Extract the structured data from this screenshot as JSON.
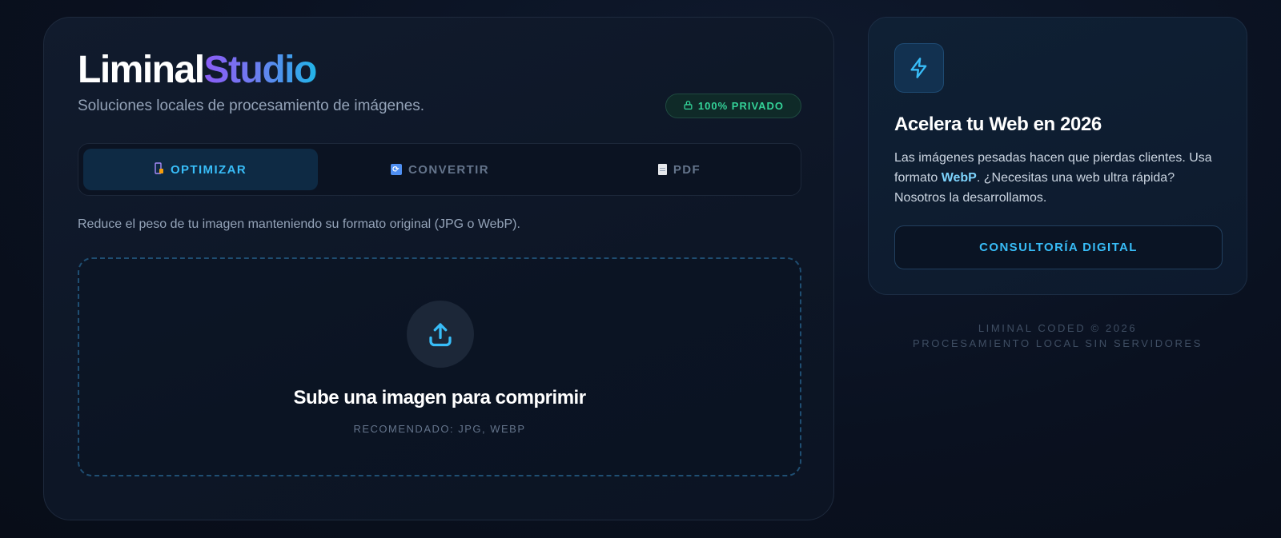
{
  "brand": {
    "name_part1": "Liminal",
    "name_part2": "Studio",
    "tagline": "Soluciones locales de procesamiento de imágenes."
  },
  "privacy_badge": {
    "label": "100% PRIVADO"
  },
  "tabs": [
    {
      "label": "OPTIMIZAR",
      "icon": "compress-icon",
      "active": true
    },
    {
      "label": "CONVERTIR",
      "icon": "convert-icon",
      "active": false
    },
    {
      "label": "PDF",
      "icon": "document-icon",
      "active": false
    }
  ],
  "description": "Reduce el peso de tu imagen manteniendo su formato original (JPG o WebP).",
  "dropzone": {
    "title": "Sube una imagen para comprimir",
    "hint": "RECOMENDADO: JPG, WEBP",
    "icon": "upload-icon"
  },
  "promo": {
    "icon": "lightning-icon",
    "title": "Acelera tu Web en 2026",
    "text_before": "Las imágenes pesadas hacen que pierdas clientes. Usa formato ",
    "highlight": "WebP",
    "text_after": ". ¿Necesitas una web ultra rápida? Nosotros la desarrollamos.",
    "button_label": "CONSULTORÍA DIGITAL"
  },
  "footer": {
    "line1": "LIMINAL CODED © 2026",
    "line2": "PROCESAMIENTO LOCAL SIN SERVIDORES"
  },
  "colors": {
    "accent": "#38bdf8",
    "brand_gradient_start": "#8b5cf6",
    "brand_gradient_end": "#22b4e8",
    "privacy_green": "#34d399"
  }
}
